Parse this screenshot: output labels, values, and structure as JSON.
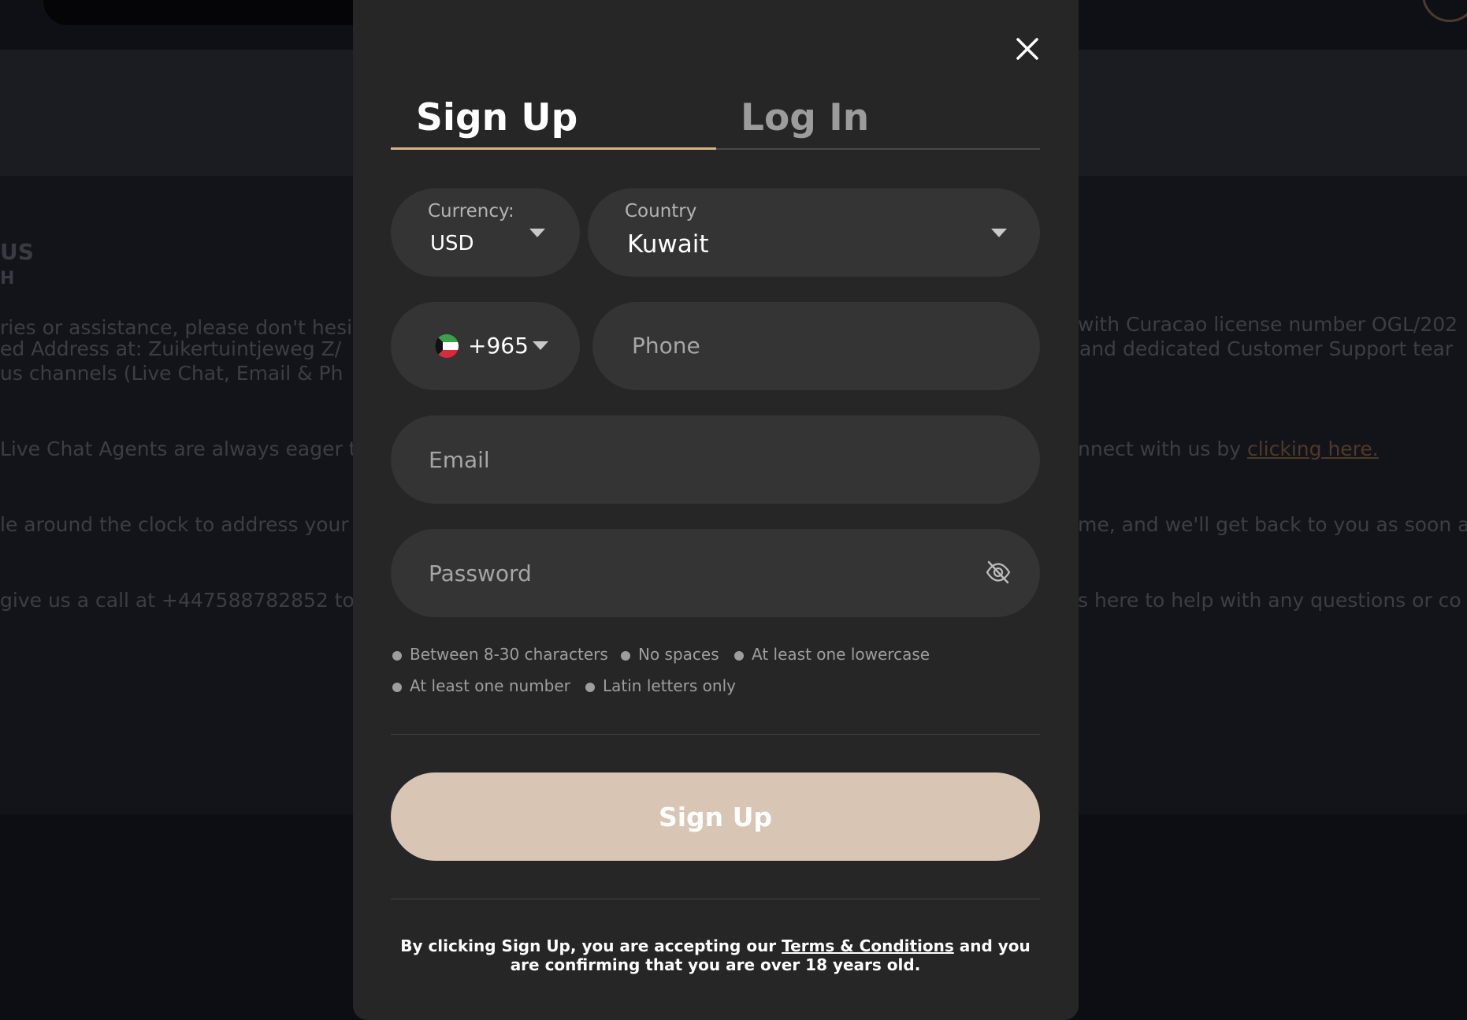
{
  "background": {
    "heading": "US",
    "subheading": "H",
    "lines_left": [
      "ries or assistance, please don't hesi",
      "ed Address at: Zuikertuintjeweg Z/",
      "us channels (Live Chat, Email & Ph",
      "Live Chat Agents are always eager t",
      "le around the clock to address your",
      "give us a call at +447588782852 to s"
    ],
    "lines_right": [
      "with Curacao license number OGL/202",
      "and dedicated Customer Support tear",
      "nnect with us by",
      "me, and we'll get back to you as soon a",
      "s here to help with any questions or co"
    ],
    "link_text": "clicking here."
  },
  "modal": {
    "close_icon": "close-icon",
    "tabs": {
      "signup": "Sign Up",
      "login": "Log In",
      "active": "signup"
    },
    "currency": {
      "label": "Currency:",
      "value": "USD"
    },
    "country": {
      "label": "Country",
      "value": "Kuwait"
    },
    "phone_code": {
      "value": "+965",
      "flag_icon": "kuwait-flag-icon"
    },
    "phone": {
      "placeholder": "Phone"
    },
    "email": {
      "placeholder": "Email"
    },
    "password": {
      "placeholder": "Password",
      "toggle_icon": "eye-off-icon"
    },
    "password_rules": [
      "Between 8-30 characters",
      "No spaces",
      "At least one lowercase",
      "At least one number",
      "Latin letters only"
    ],
    "submit_label": "Sign Up",
    "legal": {
      "prefix": "By clicking Sign Up, you are accepting our ",
      "link": "Terms & Conditions",
      "suffix": " and you are confirming that you are over 18 years old."
    }
  },
  "colors": {
    "modal_bg": "#262626",
    "field_bg": "#343434",
    "accent": "#d7b486",
    "submit_bg": "#d8c5b4"
  }
}
